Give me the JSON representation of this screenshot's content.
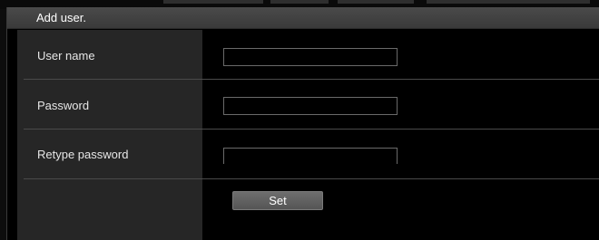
{
  "panel": {
    "title": "Add user."
  },
  "form": {
    "username": {
      "label": "User name",
      "value": ""
    },
    "password": {
      "label": "Password",
      "value": ""
    },
    "retype_password": {
      "label": "Retype password",
      "value": ""
    }
  },
  "actions": {
    "set_label": "Set"
  }
}
